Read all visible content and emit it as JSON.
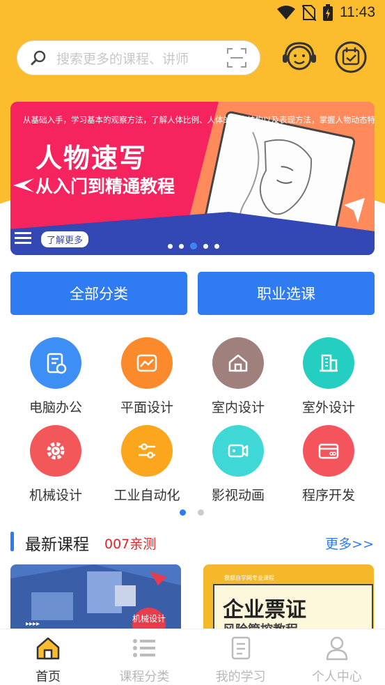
{
  "status": {
    "time": "11:43"
  },
  "search": {
    "placeholder": "搜索更多的课程、讲师"
  },
  "banner": {
    "subtitle": "从基础入手，学习基本的观察方法，了解人体比例、人体的基本结构以及表现方法，掌握人物动态特征",
    "title_line1": "人物速写",
    "title_line2": "从入门到精通教程",
    "learn_more": "了解更多",
    "slide_count": 5,
    "active_slide": 3
  },
  "buttons": {
    "all_categories": "全部分类",
    "career_select": "职业选课"
  },
  "categories": [
    {
      "label": "电脑办公",
      "icon": "document-clock-icon",
      "color": "#3d8ff5"
    },
    {
      "label": "平面设计",
      "icon": "image-icon",
      "color": "#fb8a2c"
    },
    {
      "label": "室内设计",
      "icon": "house-icon",
      "color": "#a0807c"
    },
    {
      "label": "室外设计",
      "icon": "building-icon",
      "color": "#24cfc1"
    },
    {
      "label": "机械设计",
      "icon": "gear-icon",
      "color": "#f2585a"
    },
    {
      "label": "工业自动化",
      "icon": "sliders-icon",
      "color": "#fba61c"
    },
    {
      "label": "影视动画",
      "icon": "video-camera-icon",
      "color": "#3fd8d6"
    },
    {
      "label": "程序开发",
      "icon": "card-icon",
      "color": "#f4555c"
    }
  ],
  "section": {
    "title": "最新课程",
    "tag": "007亲测",
    "more": "更多>>"
  },
  "cards": [
    {
      "badge": "机械设计"
    },
    {
      "top_text": "我都自学网专业课程",
      "title": "企业票证",
      "subtitle": "风险管控教程"
    }
  ],
  "tabs": [
    {
      "label": "首页",
      "icon": "home-icon",
      "active": true
    },
    {
      "label": "课程分类",
      "icon": "list-icon",
      "active": false
    },
    {
      "label": "我的学习",
      "icon": "notebook-icon",
      "active": false
    },
    {
      "label": "个人中心",
      "icon": "person-icon",
      "active": false
    }
  ],
  "colors": {
    "accent": "#2f7bf2",
    "header_bg": "#fbbd2e",
    "tag_red": "#e32424"
  }
}
